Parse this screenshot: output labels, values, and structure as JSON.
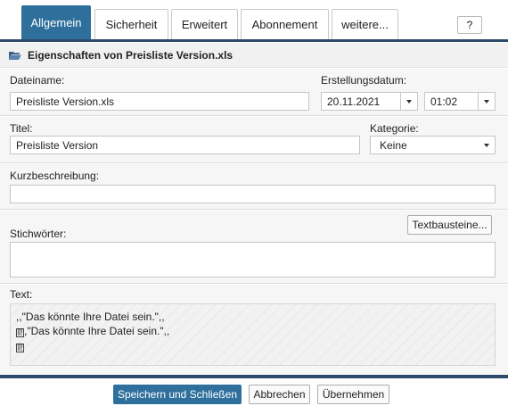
{
  "tabs": [
    {
      "label": "Allgemein",
      "active": true
    },
    {
      "label": "Sicherheit",
      "active": false
    },
    {
      "label": "Erweitert",
      "active": false
    },
    {
      "label": "Abonnement",
      "active": false
    },
    {
      "label": "weitere...",
      "active": false
    }
  ],
  "help_label": "?",
  "header": {
    "title": "Eigenschaften von Preisliste Version.xls",
    "icon": "folder-open-icon"
  },
  "filename": {
    "label": "Dateiname:",
    "value": "Preisliste Version.xls"
  },
  "created": {
    "label": "Erstellungsdatum:",
    "date": "20.11.2021",
    "time": "01:02"
  },
  "title_field": {
    "label": "Titel:",
    "value": "Preisliste Version"
  },
  "category": {
    "label": "Kategorie:",
    "value": "Keine"
  },
  "short_description": {
    "label": "Kurzbeschreibung:",
    "value": ""
  },
  "keywords": {
    "label": "Stichwörter:",
    "button_label": "Textbausteine...",
    "value": ""
  },
  "text": {
    "label": "Text:",
    "line1": ",,\"Das könnte Ihre Datei sein.\",,",
    "line2": ",\"Das könnte Ihre Datei sein.\",,"
  },
  "footer": {
    "save_label": "Speichern und Schließen",
    "cancel_label": "Abbrechen",
    "apply_label": "Übernehmen"
  },
  "colors": {
    "accent": "#2e6f9c",
    "bar": "#2e4a6a"
  }
}
